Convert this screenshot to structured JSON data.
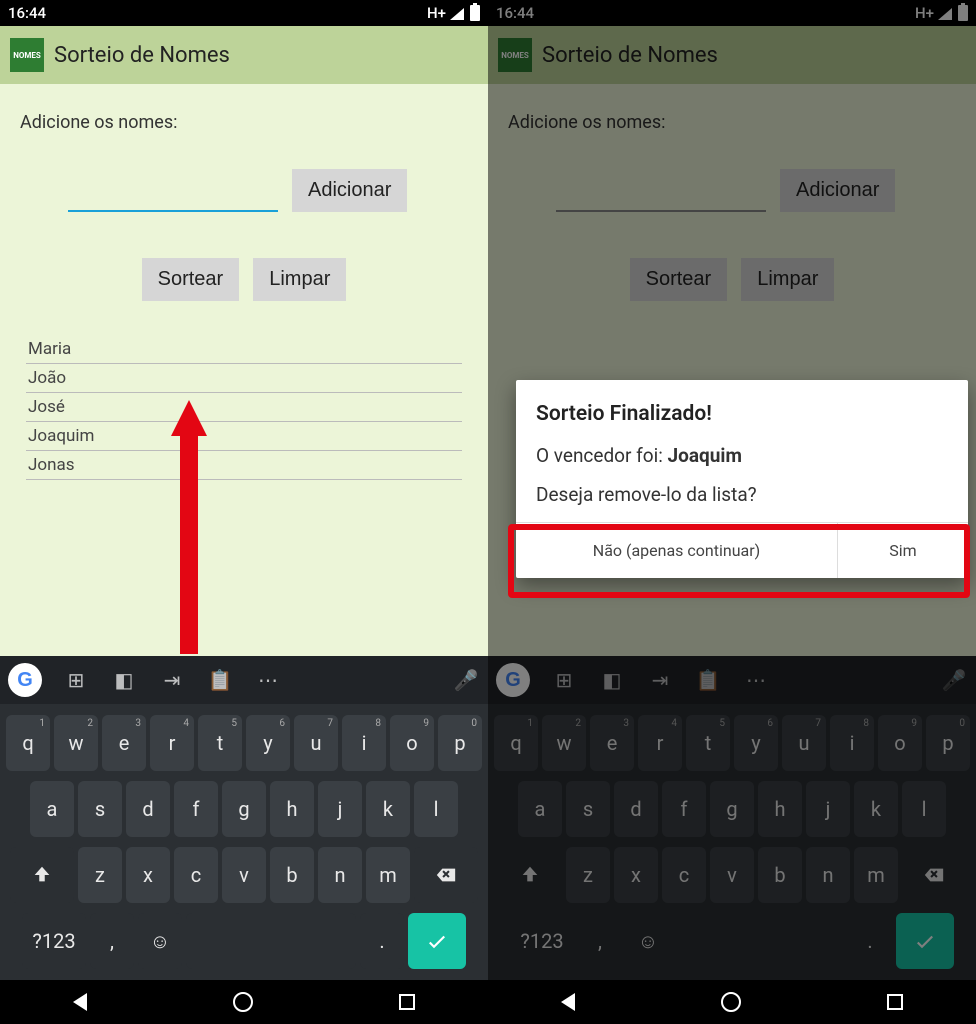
{
  "status": {
    "time": "16:44",
    "net": "H+"
  },
  "app": {
    "icon_text": "NOMES",
    "title": "Sorteio de Nomes"
  },
  "left": {
    "prompt": "Adicione os nomes:",
    "add_btn": "Adicionar",
    "sortear_btn": "Sortear",
    "limpar_btn": "Limpar",
    "names": [
      "Maria",
      "João",
      "José",
      "Joaquim",
      "Jonas"
    ]
  },
  "dialog": {
    "title": "Sorteio Finalizado!",
    "line_prefix": "O vencedor foi: ",
    "winner": "Joaquim",
    "question": "Deseja remove-lo da lista?",
    "no": "Não (apenas continuar)",
    "yes": "Sim"
  },
  "keyboard": {
    "row1": [
      [
        "q",
        "1"
      ],
      [
        "w",
        "2"
      ],
      [
        "e",
        "3"
      ],
      [
        "r",
        "4"
      ],
      [
        "t",
        "5"
      ],
      [
        "y",
        "6"
      ],
      [
        "u",
        "7"
      ],
      [
        "i",
        "8"
      ],
      [
        "o",
        "9"
      ],
      [
        "p",
        "0"
      ]
    ],
    "row2": [
      "a",
      "s",
      "d",
      "f",
      "g",
      "h",
      "j",
      "k",
      "l"
    ],
    "row3": [
      "z",
      "x",
      "c",
      "v",
      "b",
      "n",
      "m"
    ],
    "sym": "?123",
    "comma": ",",
    "period": "."
  }
}
